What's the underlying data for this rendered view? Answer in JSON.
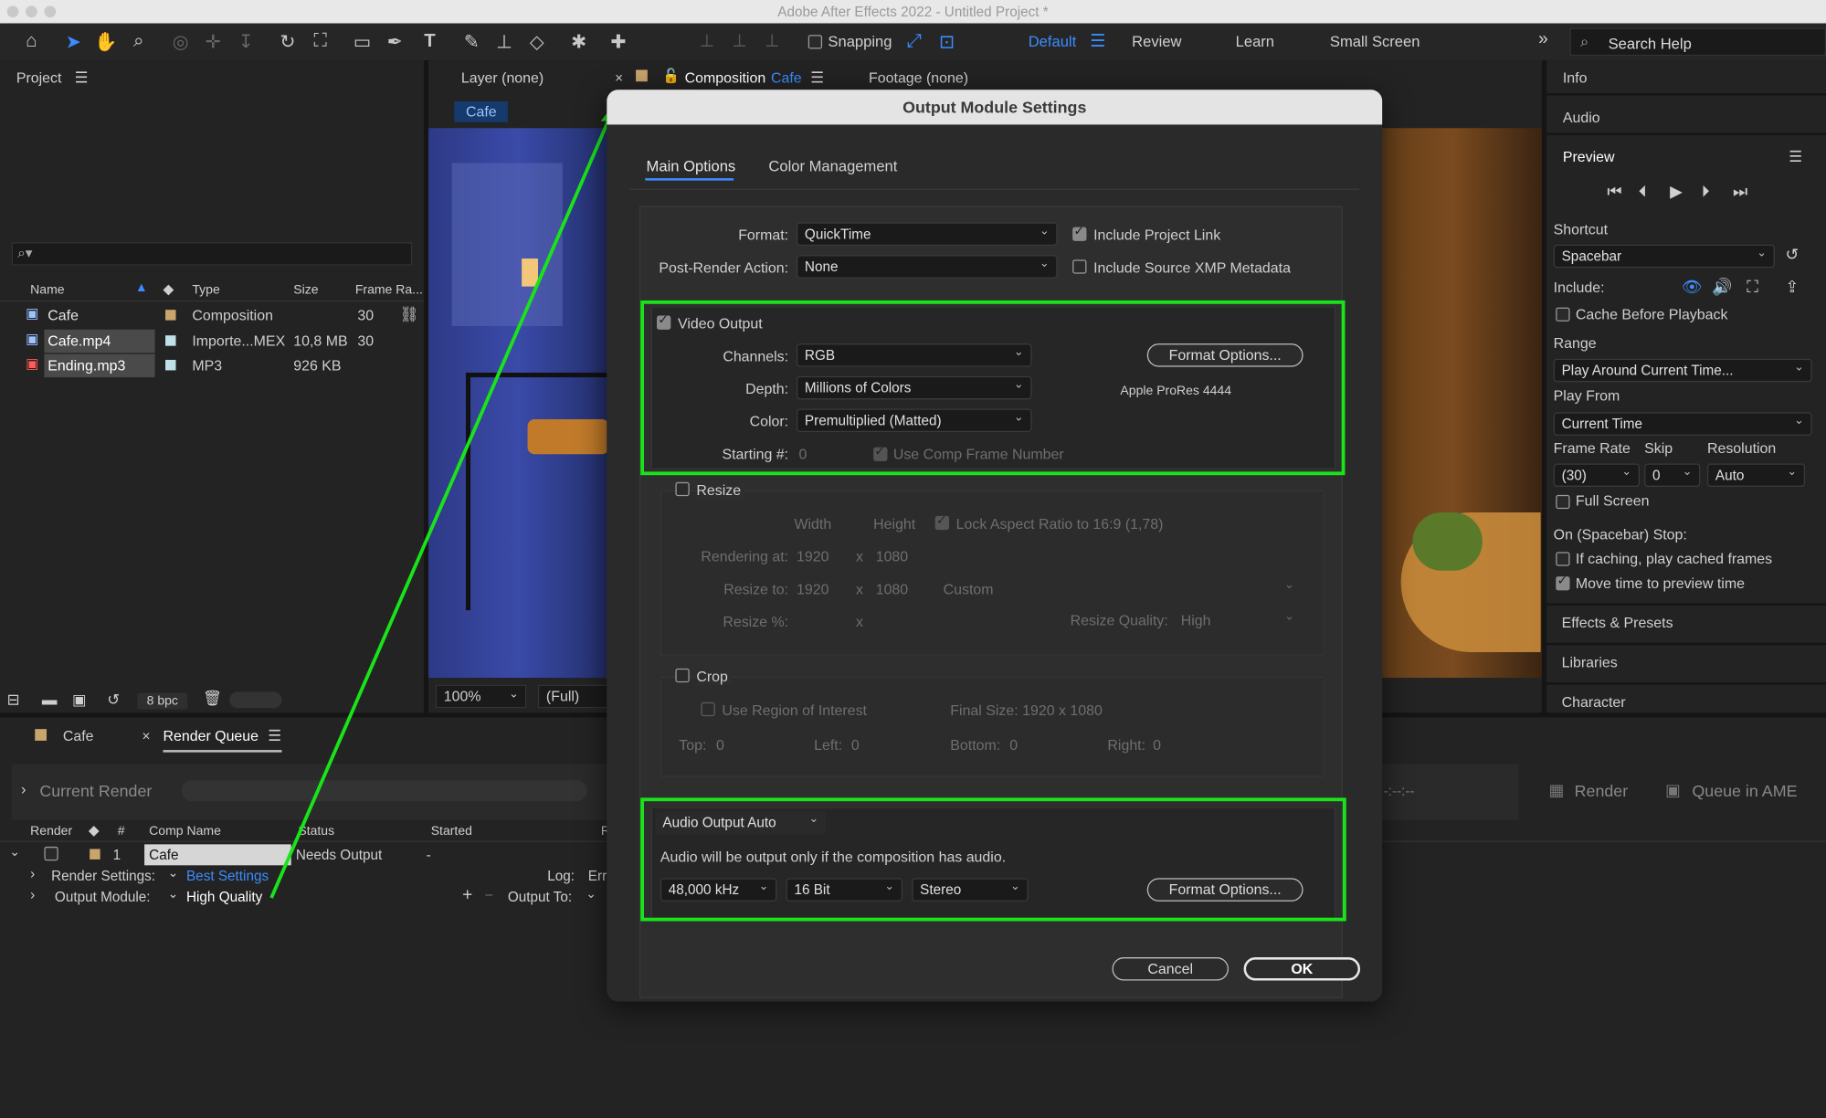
{
  "window": {
    "title": "Adobe After Effects 2022 - Untitled Project *"
  },
  "toolbar": {
    "snapping_label": "Snapping",
    "workspaces": [
      "Default",
      "Review",
      "Learn",
      "Small Screen"
    ],
    "search_placeholder": "Search Help"
  },
  "project": {
    "title": "Project",
    "columns": [
      "Name",
      "Type",
      "Size",
      "Frame Ra..."
    ],
    "items": [
      {
        "name": "Cafe",
        "type": "Composition",
        "size": "",
        "fps": "30"
      },
      {
        "name": "Cafe.mp4",
        "type": "Importe...MEX",
        "size": "10,8 MB",
        "fps": "30"
      },
      {
        "name": "Ending.mp3",
        "type": "MP3",
        "size": "926 KB",
        "fps": ""
      }
    ],
    "bpc": "8 bpc"
  },
  "viewer": {
    "layer_tab": "Layer (none)",
    "comp_tab_prefix": "Composition",
    "comp_tab_name": "Cafe",
    "footage_tab": "Footage (none)",
    "comp_chip": "Cafe",
    "zoom": "100%",
    "resolution": "(Full)"
  },
  "right_panel": {
    "info": "Info",
    "audio": "Audio",
    "preview": "Preview",
    "shortcut_label": "Shortcut",
    "shortcut_value": "Spacebar",
    "include_label": "Include:",
    "cache_before_playback": "Cache Before Playback",
    "range_label": "Range",
    "range_value": "Play Around Current Time...",
    "play_from_label": "Play From",
    "play_from_value": "Current Time",
    "frame_rate_label": "Frame Rate",
    "skip_label": "Skip",
    "resolution_label": "Resolution",
    "frame_rate_value": "(30)",
    "skip_value": "0",
    "resolution_value": "Auto",
    "full_screen": "Full Screen",
    "on_stop_label": "On (Spacebar) Stop:",
    "if_caching": "If caching, play cached frames",
    "move_time": "Move time to preview time",
    "effects_presets": "Effects & Presets",
    "libraries": "Libraries",
    "character": "Character"
  },
  "render_queue": {
    "tab_cafe": "Cafe",
    "tab_rq": "Render Queue",
    "current_render": "Current Render",
    "render_button": "Render",
    "queue_ame": "Queue in AME",
    "time_placeholder": "-:--:--",
    "columns": [
      "Render",
      "#",
      "Comp Name",
      "Status",
      "Started",
      "R"
    ],
    "row": {
      "num": "1",
      "comp": "Cafe",
      "status": "Needs Output",
      "started": "-"
    },
    "render_settings_label": "Render Settings:",
    "render_settings_value": "Best Settings",
    "log_label": "Log:",
    "log_value": "Err",
    "output_module_label": "Output Module:",
    "output_module_value": "High Quality",
    "output_to_label": "Output To:"
  },
  "dialog": {
    "title": "Output Module Settings",
    "tabs": [
      "Main Options",
      "Color Management"
    ],
    "format_label": "Format:",
    "format_value": "QuickTime",
    "include_project_link": "Include Project Link",
    "post_render_label": "Post-Render Action:",
    "post_render_value": "None",
    "include_xmp": "Include Source XMP Metadata",
    "video_output": "Video Output",
    "channels_label": "Channels:",
    "channels_value": "RGB",
    "depth_label": "Depth:",
    "depth_value": "Millions of Colors",
    "color_label": "Color:",
    "color_value": "Premultiplied (Matted)",
    "starting_label": "Starting #:",
    "starting_value": "0",
    "use_comp_frame": "Use Comp Frame Number",
    "format_options": "Format Options...",
    "codec": "Apple ProRes 4444",
    "resize": "Resize",
    "width_label": "Width",
    "height_label": "Height",
    "lock_aspect": "Lock Aspect Ratio to 16:9 (1,78)",
    "rendering_at_label": "Rendering at:",
    "rendering_w": "1920",
    "rendering_h": "1080",
    "resize_to_label": "Resize to:",
    "resize_w": "1920",
    "resize_h": "1080",
    "custom": "Custom",
    "resize_pct_label": "Resize %:",
    "x": "x",
    "resize_quality_label": "Resize Quality:",
    "resize_quality_value": "High",
    "crop": "Crop",
    "use_roi": "Use Region of Interest",
    "final_size": "Final Size: 1920 x 1080",
    "top_label": "Top:",
    "top_value": "0",
    "left_label": "Left:",
    "left_value": "0",
    "bottom_label": "Bottom:",
    "bottom_value": "0",
    "right_label": "Right:",
    "right_value": "0",
    "audio_output": "Audio Output Auto",
    "audio_note": "Audio will be output only if the composition has audio.",
    "sample_rate": "48,000 kHz",
    "bit_depth": "16 Bit",
    "channels_audio": "Stereo",
    "audio_format_options": "Format Options...",
    "cancel": "Cancel",
    "ok": "OK"
  },
  "colors": {
    "highlight": "#19e319",
    "accent": "#3b8cff"
  }
}
